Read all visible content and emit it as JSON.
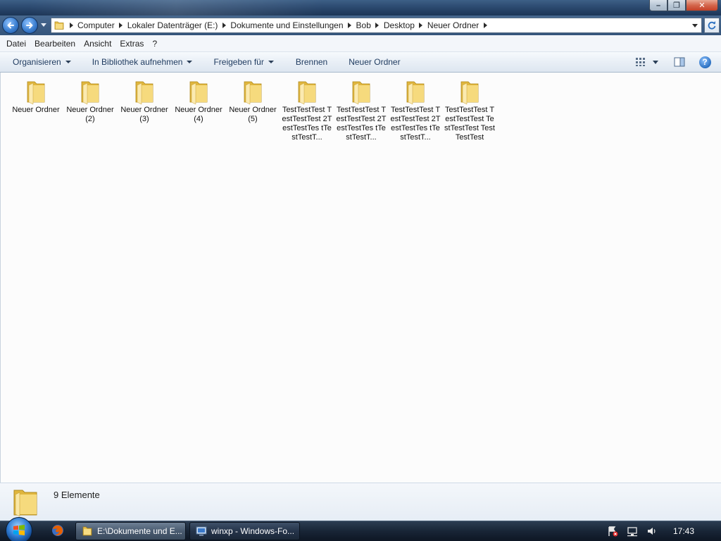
{
  "window": {
    "minimize_symbol": "–",
    "maximize_symbol": "❐",
    "close_symbol": "✕"
  },
  "address_bar": {
    "crumbs": [
      "Computer",
      "Lokaler Datenträger (E:)",
      "Dokumente und Einstellungen",
      "Bob",
      "Desktop",
      "Neuer Ordner"
    ]
  },
  "menubar": {
    "items": [
      "Datei",
      "Bearbeiten",
      "Ansicht",
      "Extras",
      "?"
    ]
  },
  "commandbar": {
    "organize": "Organisieren",
    "library": "In Bibliothek aufnehmen",
    "share": "Freigeben für",
    "burn": "Brennen",
    "new_folder": "Neuer Ordner",
    "help_symbol": "?"
  },
  "files": [
    {
      "label": "Neuer Ordner"
    },
    {
      "label": "Neuer Ordner (2)"
    },
    {
      "label": "Neuer Ordner (3)"
    },
    {
      "label": "Neuer Ordner (4)"
    },
    {
      "label": "Neuer Ordner (5)"
    },
    {
      "label": "TestTestTest TestTestTest 2TestTestTes tTestTestT..."
    },
    {
      "label": "TestTestTest TestTestTest 2TestTestTes tTestTestT..."
    },
    {
      "label": "TestTestTest TestTestTest 2TestTestTes tTestTestT..."
    },
    {
      "label": "TestTestTest TestTestTest TestTestTest TestTestTest"
    }
  ],
  "details": {
    "count_text": "9 Elemente"
  },
  "taskbar": {
    "tasks": [
      {
        "label": "E:\\Dokumente und E..."
      },
      {
        "label": "winxp - Windows-Fo..."
      }
    ],
    "clock": "17:43"
  },
  "colors": {
    "folder_yellow": "#f3d26a",
    "command_text": "#1e3a5f",
    "accent_blue": "#3c7fd0"
  }
}
